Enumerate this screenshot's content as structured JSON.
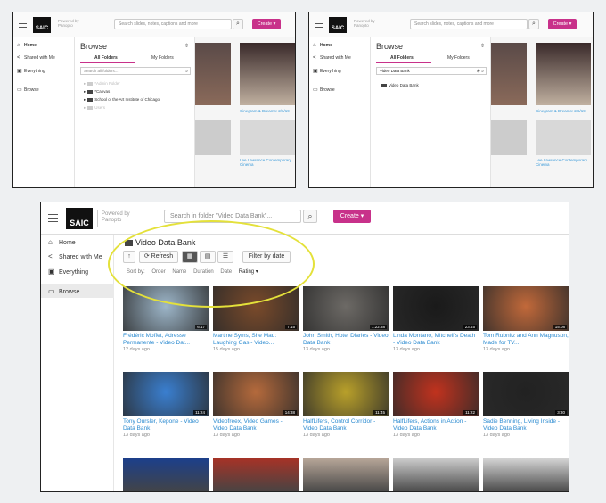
{
  "app": {
    "logo": "SAIC",
    "powered_by": "Powered by\nPanopto",
    "create_label": "Create ▾",
    "search_icon": "magnifier-icon"
  },
  "shot1": {
    "search_placeholder": "Search slides, notes, captions and more",
    "nav": [
      "Home",
      "Shared with Me",
      "Everything",
      "Browse"
    ],
    "browse_title": "Browse",
    "tabs": [
      "All Folders",
      "My Folders"
    ],
    "folder_search": "Search all folders...",
    "folders": [
      "*Admin Folder",
      "*Canvas",
      "School of the Art Institute of Chicago",
      "Users"
    ],
    "back_caption": "Cinegram & Dreams: 2/6/19",
    "back_caption2": "Lee Lawrence Contemporary Cinema"
  },
  "shot2": {
    "search_placeholder": "Search slides, notes, captions and more",
    "nav": [
      "Home",
      "Shared with Me",
      "Everything",
      "Browse"
    ],
    "browse_title": "Browse",
    "tabs": [
      "All Folders",
      "My Folders"
    ],
    "folder_search_value": "Video Data Bank",
    "result": "Video Data Bank",
    "back_caption": "Cinegram & Dreams: 2/6/19",
    "back_caption2": "Lee Lawrence Contemporary Cinema"
  },
  "shot3": {
    "search_placeholder": "Search in folder \"Video Data Bank\"...",
    "nav": [
      "Home",
      "Shared with Me",
      "Everything",
      "Browse"
    ],
    "folder_title": "Video Data Bank",
    "refresh": "Refresh",
    "filter": "Filter by date",
    "sort_label": "Sort by:",
    "sort_options": [
      "Order",
      "Name",
      "Duration",
      "Date",
      "Rating ▾"
    ],
    "videos": [
      {
        "title": "Frédéric Moffet, Adresse Permanente - Video Dat...",
        "age": "12 days ago",
        "dur": "6:17",
        "color": "#9db6c9"
      },
      {
        "title": "Martine Syms, She Mad: Laughing Gas - Video...",
        "age": "15 days ago",
        "dur": "7:15",
        "color": "#7a4a2a"
      },
      {
        "title": "John Smith, Hotel Diaries - Video Data Bank",
        "age": "13 days ago",
        "dur": "1:22:38",
        "color": "#6d6a66"
      },
      {
        "title": "Linda Montano, Mitchell's Death - Video Data Bank",
        "age": "13 days ago",
        "dur": "23:45",
        "color": "#1a1a1a"
      },
      {
        "title": "Tom Rubnitz and Ann Magnuson, Made for TV...",
        "age": "13 days ago",
        "dur": "15:08",
        "color": "#c2693a"
      },
      {
        "title": "Tony Oursler, Kepone - Video Data Bank",
        "age": "13 days ago",
        "dur": "11:24",
        "color": "#3a7fd0"
      },
      {
        "title": "Videofreex, Video Games - Video Data Bank",
        "age": "13 days ago",
        "dur": "14:38",
        "color": "#b56a3c"
      },
      {
        "title": "HalfLifers, Control Corridor - Video Data Bank",
        "age": "13 days ago",
        "dur": "11:45",
        "color": "#b9a02a"
      },
      {
        "title": "HalfLifers, Actions in Action - Video Data Bank",
        "age": "13 days ago",
        "dur": "11:22",
        "color": "#c1321e"
      },
      {
        "title": "Sadie Benning, Living Inside - Video Data Bank",
        "age": "13 days ago",
        "dur": "3:30",
        "color": "#222222"
      }
    ],
    "row3_colors": [
      "#1b3f8c",
      "#a83226",
      "#b9a89a",
      "#cfcfcf",
      "#d8d8d8"
    ]
  }
}
